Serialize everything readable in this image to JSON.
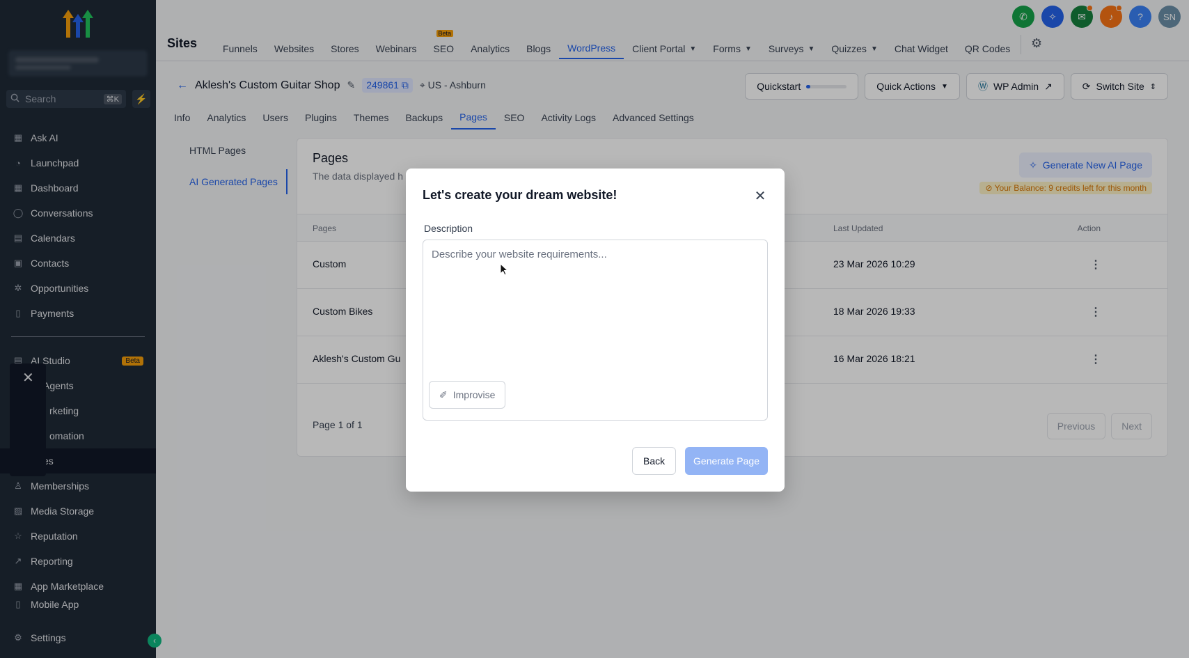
{
  "colors": {
    "sidebar_bg": "#1f2a37",
    "accent": "#2563eb",
    "beta": "#f59e0b",
    "generate_disabled": "#93b4f5"
  },
  "sidebar": {
    "search_placeholder": "Search",
    "search_shortcut": "⌘K",
    "items": [
      {
        "label": "Ask AI",
        "icon": "grid-icon"
      },
      {
        "label": "Launchpad",
        "icon": "rocket-icon"
      },
      {
        "label": "Dashboard",
        "icon": "grid-icon"
      },
      {
        "label": "Conversations",
        "icon": "chat-icon"
      },
      {
        "label": "Calendars",
        "icon": "calendar-icon"
      },
      {
        "label": "Contacts",
        "icon": "contacts-icon"
      },
      {
        "label": "Opportunities",
        "icon": "opportunities-icon"
      },
      {
        "label": "Payments",
        "icon": "payments-icon"
      }
    ],
    "ai_studio": {
      "label": "AI Studio",
      "badge": "Beta"
    },
    "sub_items": [
      {
        "label": "Agents"
      },
      {
        "label": "rketing"
      },
      {
        "label": "omation"
      },
      {
        "label": "es"
      }
    ],
    "items_lower": [
      {
        "label": "Memberships",
        "icon": "memberships-icon"
      },
      {
        "label": "Media Storage",
        "icon": "image-icon"
      },
      {
        "label": "Reputation",
        "icon": "star-icon"
      },
      {
        "label": "Reporting",
        "icon": "chart-icon"
      },
      {
        "label": "App Marketplace",
        "icon": "grid-icon"
      },
      {
        "label": "Mobile App",
        "icon": "mobile-icon"
      }
    ],
    "settings_label": "Settings"
  },
  "topbar": {
    "section_title": "Sites",
    "tabs": [
      {
        "label": "Funnels"
      },
      {
        "label": "Websites"
      },
      {
        "label": "Stores"
      },
      {
        "label": "Webinars"
      },
      {
        "label": "SEO",
        "badge": "Beta"
      },
      {
        "label": "Analytics"
      },
      {
        "label": "Blogs"
      },
      {
        "label": "WordPress",
        "active": true
      },
      {
        "label": "Client Portal",
        "dropdown": true
      },
      {
        "label": "Forms",
        "dropdown": true
      },
      {
        "label": "Surveys",
        "dropdown": true
      },
      {
        "label": "Quizzes",
        "dropdown": true
      },
      {
        "label": "Chat Widget"
      },
      {
        "label": "QR Codes"
      }
    ],
    "avatar_initials": "SN"
  },
  "site": {
    "name": "Aklesh's Custom Guitar Shop",
    "id": "249861",
    "location": "US - Ashburn",
    "quickstart_label": "Quickstart",
    "quickstart_progress": 0.1,
    "quick_actions_label": "Quick Actions",
    "wp_admin_label": "WP Admin",
    "switch_site_label": "Switch Site"
  },
  "subtabs": [
    {
      "label": "Info"
    },
    {
      "label": "Analytics"
    },
    {
      "label": "Users"
    },
    {
      "label": "Plugins"
    },
    {
      "label": "Themes"
    },
    {
      "label": "Backups"
    },
    {
      "label": "Pages",
      "active": true
    },
    {
      "label": "SEO"
    },
    {
      "label": "Activity Logs"
    },
    {
      "label": "Advanced Settings"
    }
  ],
  "left_menu": [
    {
      "label": "HTML Pages"
    },
    {
      "label": "AI Generated Pages",
      "active": true
    }
  ],
  "panel": {
    "title": "Pages",
    "description": "The data displayed h",
    "generate_button": "Generate New AI Page",
    "balance": "Your Balance: 9 credits left for this month",
    "columns": {
      "pages": "Pages",
      "last_updated": "Last Updated",
      "action": "Action"
    },
    "rows": [
      {
        "page": "Custom",
        "updated": "23 Mar 2026 10:29"
      },
      {
        "page": "Custom Bikes",
        "updated": "18 Mar 2026 19:33"
      },
      {
        "page": "Aklesh's Custom Gu",
        "updated": "16 Mar 2026 18:21"
      }
    ],
    "page_info": "Page 1 of 1",
    "previous_label": "Previous",
    "next_label": "Next"
  },
  "modal": {
    "title": "Let's create your dream website!",
    "description_label": "Description",
    "placeholder": "Describe your website requirements...",
    "value": "",
    "improve_label": "Improvise",
    "back_label": "Back",
    "generate_label": "Generate Page"
  }
}
